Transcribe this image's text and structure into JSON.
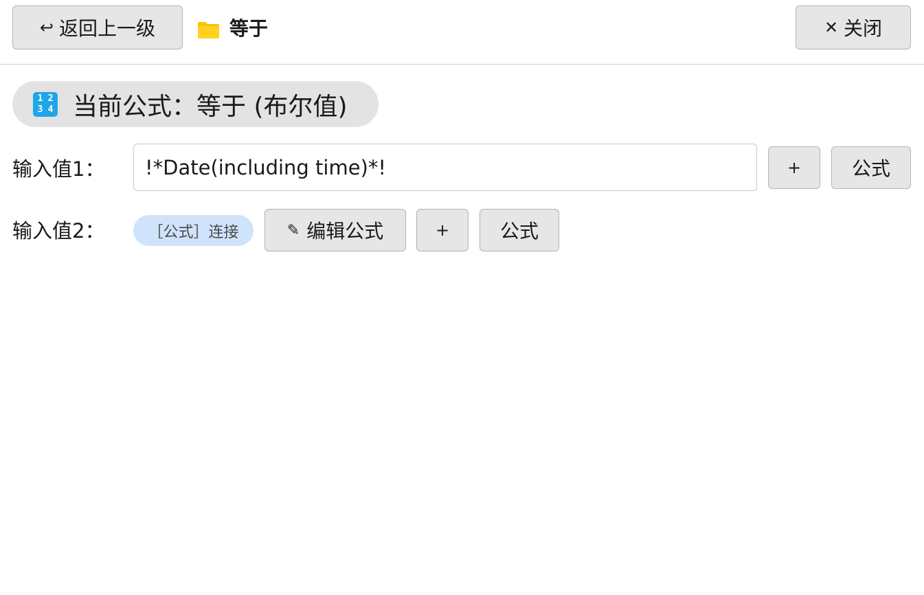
{
  "header": {
    "back_glyph": "↩",
    "back_label": "返回上一级",
    "folder_title": "等于",
    "folder_color": "#F9C300",
    "close_glyph": "✕",
    "close_label": "关闭"
  },
  "formula": {
    "icon_digits": [
      "1",
      "2",
      "3",
      "4"
    ],
    "icon_color": "#1FA6E8",
    "text": "当前公式：等于 (布尔值)"
  },
  "inputs": [
    {
      "label": "输入值1：",
      "value": "!*Date(including time)*!",
      "plus_label": "+",
      "formula_label": "公式"
    },
    {
      "label": "输入值2：",
      "tag_label": "［公式］连接",
      "tag_color": "#D0E3FD",
      "edit_icon": "✎",
      "edit_label": "编辑公式",
      "plus_label": "+",
      "formula_label": "公式"
    }
  ]
}
